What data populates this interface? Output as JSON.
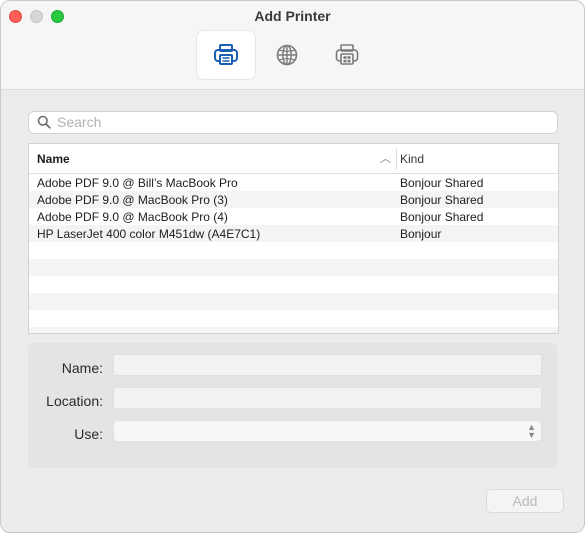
{
  "window": {
    "title": "Add Printer"
  },
  "toolbar": {
    "tools": [
      {
        "icon": "printer-icon",
        "active": true
      },
      {
        "icon": "globe-icon",
        "active": false
      },
      {
        "icon": "windows-printer-icon",
        "active": false
      }
    ]
  },
  "search": {
    "placeholder": "Search",
    "value": ""
  },
  "table": {
    "columns": {
      "name": "Name",
      "kind": "Kind",
      "sort": "ascending"
    },
    "rows": [
      {
        "name": "Adobe PDF 9.0 @ Bill’s MacBook Pro",
        "kind": "Bonjour Shared"
      },
      {
        "name": "Adobe PDF 9.0 @ MacBook Pro (3)",
        "kind": "Bonjour Shared"
      },
      {
        "name": "Adobe PDF 9.0 @ MacBook Pro (4)",
        "kind": "Bonjour Shared"
      },
      {
        "name": "HP LaserJet 400 color M451dw (A4E7C1)",
        "kind": "Bonjour"
      }
    ]
  },
  "form": {
    "name_label": "Name:",
    "name_value": "",
    "location_label": "Location:",
    "location_value": "",
    "use_label": "Use:",
    "use_value": ""
  },
  "actions": {
    "add_label": "Add"
  }
}
